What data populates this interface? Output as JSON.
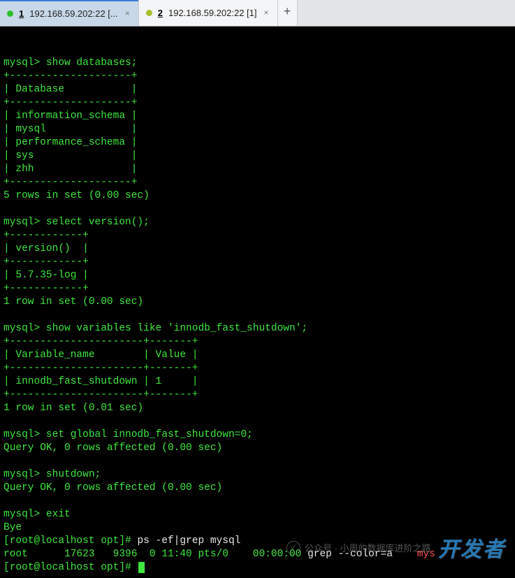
{
  "tabs": {
    "active": {
      "num": "1",
      "label": "192.168.59.202:22 [..."
    },
    "inactive": {
      "num": "2",
      "label": "192.168.59.202:22 [1]"
    }
  },
  "terminal": {
    "blank": "",
    "p_show_db": "mysql> show databases;",
    "sep_db": "+--------------------+",
    "hdr_db": "| Database           |",
    "row_db1": "| information_schema |",
    "row_db2": "| mysql              |",
    "row_db3": "| performance_schema |",
    "row_db4": "| sys                |",
    "row_db5": "| zhh                |",
    "res_db": "5 rows in set (0.00 sec)",
    "p_ver": "mysql> select version();",
    "sep_ver": "+------------+",
    "hdr_ver": "| version()  |",
    "row_ver": "| 5.7.35-log |",
    "res_ver": "1 row in set (0.00 sec)",
    "p_var": "mysql> show variables like 'innodb_fast_shutdown';",
    "sep_var": "+----------------------+-------+",
    "hdr_var": "| Variable_name        | Value |",
    "row_var": "| innodb_fast_shutdown | 1     |",
    "res_var": "1 row in set (0.01 sec)",
    "p_set": "mysql> set global innodb_fast_shutdown=0;",
    "res_set": "Query OK, 0 rows affected (0.00 sec)",
    "p_shut": "mysql> shutdown;",
    "res_shut": "Query OK, 0 rows affected (0.00 sec)",
    "p_exit": "mysql> exit",
    "bye": "Bye",
    "shell1_prefix": "[root@localhost opt]# ",
    "shell1_cmd": "ps -ef|grep mysql",
    "ps_line_1": "root      17623   9396  0 11:40 pts/0    00:00:00 ",
    "ps_line_2": "grep --color=a",
    "ps_line_red": "mys",
    "shell2_prefix": "[root@localhost opt]# "
  },
  "watermark": {
    "source": "公众号 · 小周的数据库进阶之路",
    "brand": "开发者"
  }
}
